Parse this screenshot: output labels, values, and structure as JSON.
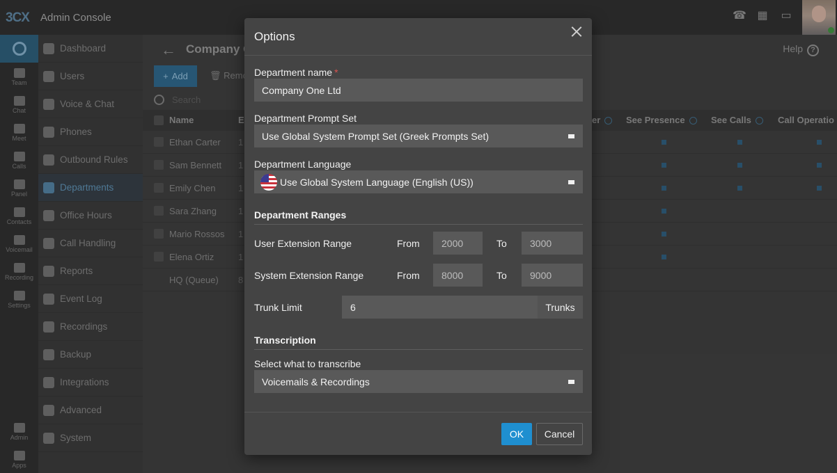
{
  "app": {
    "logo": "3CX",
    "title": "Admin Console"
  },
  "topbar_icons": [
    "phone-icon",
    "qr-code-icon",
    "book-icon"
  ],
  "rail": [
    {
      "label": "Team"
    },
    {
      "label": "Chat"
    },
    {
      "label": "Meet"
    },
    {
      "label": "Calls"
    },
    {
      "label": "Panel"
    },
    {
      "label": "Contacts"
    },
    {
      "label": "Voicemail"
    },
    {
      "label": "Recording"
    },
    {
      "label": "Settings"
    },
    {
      "label": "Admin"
    },
    {
      "label": "Apps"
    }
  ],
  "sidenav": [
    {
      "label": "Dashboard",
      "icon": "dashboard-icon"
    },
    {
      "label": "Users",
      "icon": "user-icon"
    },
    {
      "label": "Voice & Chat",
      "icon": "globe-icon"
    },
    {
      "label": "Phones",
      "icon": "phone-grid-icon"
    },
    {
      "label": "Outbound Rules",
      "icon": "arrow-up-icon"
    },
    {
      "label": "Departments",
      "icon": "departments-icon",
      "active": true
    },
    {
      "label": "Office Hours",
      "icon": "clock-icon"
    },
    {
      "label": "Call Handling",
      "icon": "phone-icon"
    },
    {
      "label": "Reports",
      "icon": "reports-icon"
    },
    {
      "label": "Event Log",
      "icon": "history-icon"
    },
    {
      "label": "Recordings",
      "icon": "record-icon"
    },
    {
      "label": "Backup",
      "icon": "backup-icon"
    },
    {
      "label": "Integrations",
      "icon": "puzzle-icon"
    },
    {
      "label": "Advanced",
      "icon": "gear-icon"
    },
    {
      "label": "System",
      "icon": "wrench-icon"
    }
  ],
  "page": {
    "title": "Company O",
    "help": "Help",
    "add_label": "Add",
    "remove_label": "Remo",
    "search_placeholder": "Search"
  },
  "table": {
    "columns": [
      "Name",
      "E",
      "er",
      "See Presence",
      "See Calls",
      "Call Operatio"
    ],
    "rows": [
      {
        "name": "Ethan Carter",
        "ext": "1"
      },
      {
        "name": "Sam Bennett",
        "ext": "1"
      },
      {
        "name": "Emily Chen",
        "ext": "1"
      },
      {
        "name": "Sara Zhang",
        "ext": "1"
      },
      {
        "name": "Mario Rossos",
        "ext": "1"
      },
      {
        "name": "Elena Ortiz",
        "ext": "1"
      },
      {
        "name": "HQ (Queue)",
        "ext": "8"
      }
    ]
  },
  "modal": {
    "title": "Options",
    "department_name_label": "Department name",
    "required_mark": "*",
    "department_name_value": "Company One Ltd",
    "prompt_set_label": "Department Prompt Set",
    "prompt_set_value": "Use Global System Prompt Set (Greek Prompts Set)",
    "language_label": "Department Language",
    "language_value": "Use Global System Language (English (US))",
    "ranges_heading": "Department Ranges",
    "user_range_label": "User Extension Range",
    "system_range_label": "System Extension Range",
    "from_label": "From",
    "to_label": "To",
    "user_from": "2000",
    "user_to": "3000",
    "system_from": "8000",
    "system_to": "9000",
    "trunk_limit_label": "Trunk Limit",
    "trunk_limit_value": "6",
    "trunk_limit_suffix": "Trunks",
    "transcription_heading": "Transcription",
    "transcribe_label": "Select what to transcribe",
    "transcribe_value": "Voicemails & Recordings",
    "ok_label": "OK",
    "cancel_label": "Cancel"
  }
}
